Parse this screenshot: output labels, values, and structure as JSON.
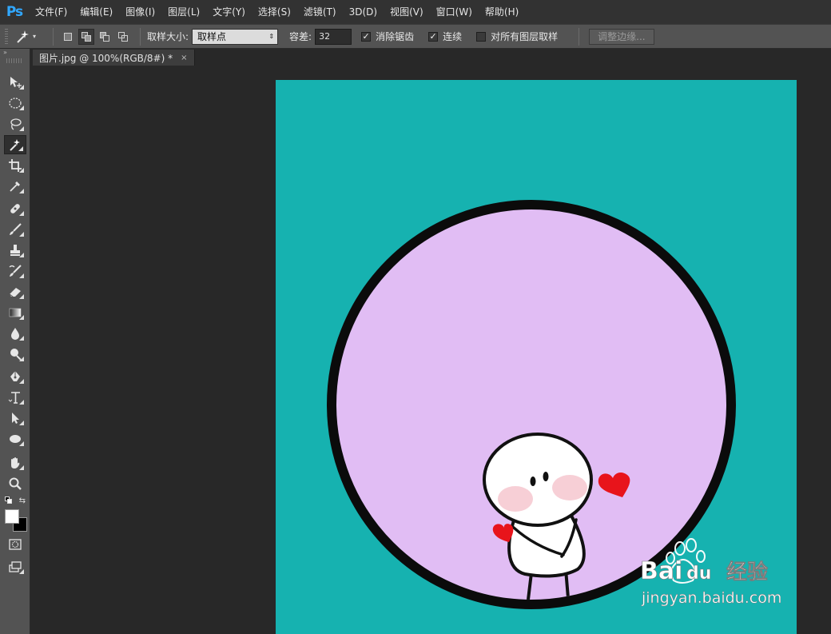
{
  "app": {
    "logo": "Ps"
  },
  "menu": [
    "文件(F)",
    "编辑(E)",
    "图像(I)",
    "图层(L)",
    "文字(Y)",
    "选择(S)",
    "滤镜(T)",
    "3D(D)",
    "视图(V)",
    "窗口(W)",
    "帮助(H)"
  ],
  "options": {
    "tool_icon": "magic-wand-icon",
    "sample_size_label": "取样大小:",
    "sample_size_value": "取样点",
    "tolerance_label": "容差:",
    "tolerance_value": "32",
    "antialias_label": "消除锯齿",
    "antialias_checked": true,
    "contiguous_label": "连续",
    "contiguous_checked": true,
    "sample_all_label": "对所有图层取样",
    "sample_all_checked": false,
    "refine_edge_label": "调整边缘..."
  },
  "document": {
    "tab_title": "图片.jpg @ 100%(RGB/8#) *",
    "close_glyph": "×"
  },
  "colors": {
    "foreground": "#ffffff",
    "background": "#000000",
    "canvas_bg": "#16b2b0",
    "circle_fill": "#e1bdf4",
    "heart": "#e8141b"
  },
  "tools": [
    "move-icon",
    "marquee-icon",
    "lasso-icon",
    "magic-wand-icon",
    "crop-icon",
    "eyedropper-icon",
    "healing-brush-icon",
    "brush-icon",
    "clone-stamp-icon",
    "history-brush-icon",
    "eraser-icon",
    "gradient-icon",
    "blur-icon",
    "dodge-icon",
    "pen-icon",
    "type-icon",
    "path-selection-icon",
    "ellipse-icon",
    "hand-icon",
    "zoom-icon",
    "quick-mask-icon",
    "screen-mode-icon"
  ],
  "watermark": {
    "brand": "Bai",
    "brand2": "du",
    "brand_cn": "经验",
    "url": "jingyan.baidu.com"
  }
}
